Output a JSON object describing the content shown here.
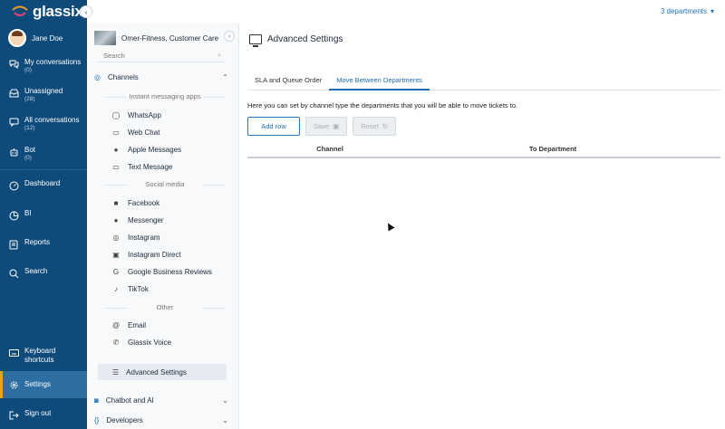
{
  "app": {
    "logo_text": "glassix",
    "department_switch": "3 departments"
  },
  "user": {
    "name": "Jane Doe"
  },
  "nav": {
    "items": [
      {
        "label": "My conversations",
        "count": "(0)"
      },
      {
        "label": "Unassigned",
        "count": "(28)"
      },
      {
        "label": "All conversations",
        "count": "(12)"
      },
      {
        "label": "Bot",
        "count": "(0)"
      },
      {
        "label": "Dashboard"
      },
      {
        "label": "BI"
      },
      {
        "label": "Reports"
      },
      {
        "label": "Search"
      }
    ],
    "bottom": [
      {
        "label": "Keyboard shortcuts"
      },
      {
        "label": "Settings"
      },
      {
        "label": "Sign out"
      }
    ]
  },
  "subnav": {
    "department": "Omer-Fitness, Customer Care",
    "search_placeholder": "Search",
    "channels_label": "Channels",
    "groups": {
      "instant": "Instant messaging apps",
      "social": "Social media",
      "other": "Other"
    },
    "instant_items": [
      "WhatsApp",
      "Web Chat",
      "Apple Messages",
      "Text Message"
    ],
    "social_items": [
      "Facebook",
      "Messenger",
      "Instagram",
      "Instagram Direct",
      "Google Business Reviews",
      "TikTok"
    ],
    "other_items": [
      "Email",
      "Glassix Voice"
    ],
    "advanced": "Advanced Settings",
    "chatbot_label": "Chatbot and AI",
    "developers_label": "Developers"
  },
  "main": {
    "title": "Advanced Settings",
    "tabs": [
      "SLA and Queue Order",
      "Move Between Departments"
    ],
    "description": "Here you can set by channel type the departments that you will be able to move tickets to.",
    "buttons": {
      "add": "Add row",
      "save": "Save",
      "reset": "Reset"
    },
    "columns": [
      "Channel",
      "To Department"
    ]
  },
  "colors": {
    "nav_bg": "#0e4a7a",
    "accent": "#1e6cb0",
    "active_marker": "#f0a020"
  }
}
